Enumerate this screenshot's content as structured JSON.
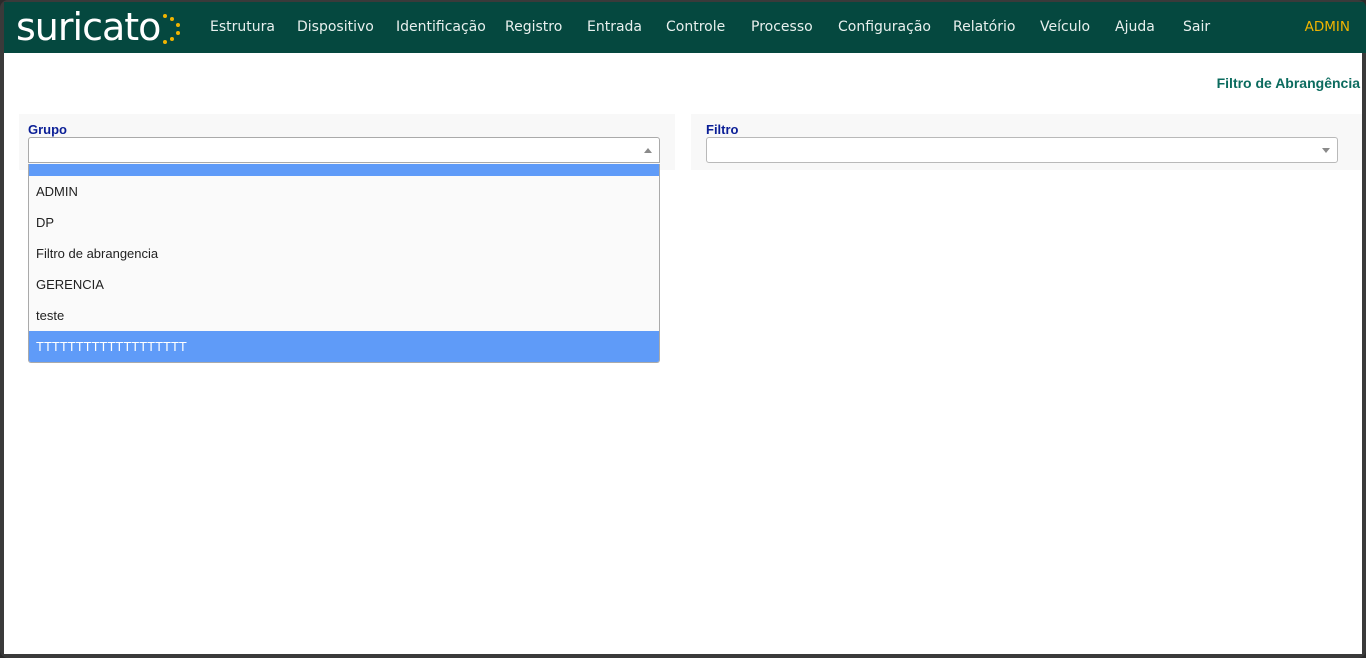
{
  "header": {
    "logo_text": "suricato",
    "nav": [
      {
        "label": "Estrutura"
      },
      {
        "label": "Dispositivo"
      },
      {
        "label": "Identificação"
      },
      {
        "label": "Registro"
      },
      {
        "label": "Entrada"
      },
      {
        "label": "Controle"
      },
      {
        "label": "Processo"
      },
      {
        "label": "Configuração"
      },
      {
        "label": "Relatório"
      },
      {
        "label": "Veículo"
      },
      {
        "label": "Ajuda"
      },
      {
        "label": "Sair"
      }
    ],
    "user": "ADMIN"
  },
  "page": {
    "title": "Filtro de Abrangência"
  },
  "form": {
    "grupo": {
      "label": "Grupo",
      "value": "",
      "state": "open",
      "options": [
        "",
        "ADMIN",
        "DP",
        "Filtro de abrangencia",
        "GERENCIA",
        "teste",
        "TTTTTTTTTTTTTTTTTTT"
      ],
      "highlighted_option": "TTTTTTTTTTTTTTTTTTT"
    },
    "filtro": {
      "label": "Filtro",
      "value": ""
    }
  },
  "colors": {
    "navbar": "#05483f",
    "user": "#f0b400",
    "label": "#0a1e96",
    "title": "#0b6b5e",
    "highlight": "#5f9bf8",
    "logo_dots": "#f0b400"
  }
}
